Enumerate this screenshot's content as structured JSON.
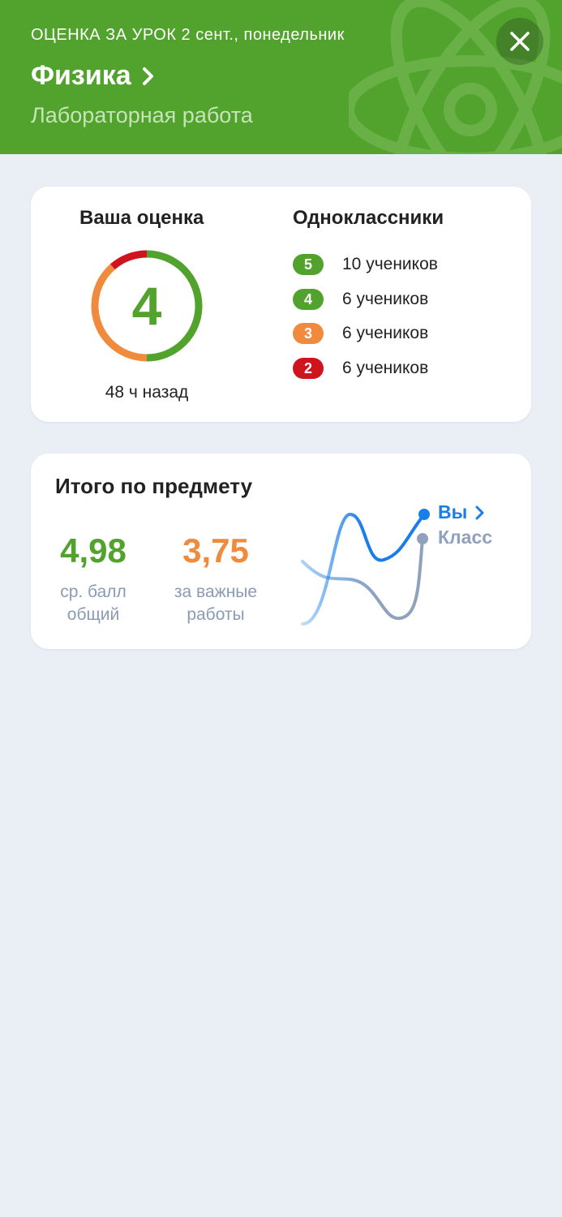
{
  "header": {
    "overline": "ОЦЕНКА ЗА УРОК 2 сент., понедельник",
    "subject": "Физика",
    "work_type": "Лабораторная работа",
    "background_color": "#52a32e",
    "close_icon": "close-icon",
    "chevron_icon": "chevron-right-icon"
  },
  "your_grade": {
    "title": "Ваша оценка",
    "value": "4",
    "time_ago": "48 ч назад"
  },
  "classmates": {
    "title": "Одноклассники",
    "rows": [
      {
        "grade": "5",
        "count": "10 учеников",
        "color": "#52a32e"
      },
      {
        "grade": "4",
        "count": "6 учеников",
        "color": "#52a32e"
      },
      {
        "grade": "3",
        "count": "6 учеников",
        "color": "#f08a3c"
      },
      {
        "grade": "2",
        "count": "6 учеников",
        "color": "#d0141e"
      }
    ]
  },
  "summary": {
    "title": "Итого по предмету",
    "overall_avg": "4,98",
    "overall_avg_label": "ср. балл общий",
    "important_avg": "3,75",
    "important_avg_label": "за важные работы",
    "legend_you": "Вы",
    "legend_class": "Класс",
    "colors": {
      "you": "#1a7de8",
      "class": "#8fa1bd",
      "green": "#52a32e",
      "orange": "#f08a3c"
    }
  }
}
